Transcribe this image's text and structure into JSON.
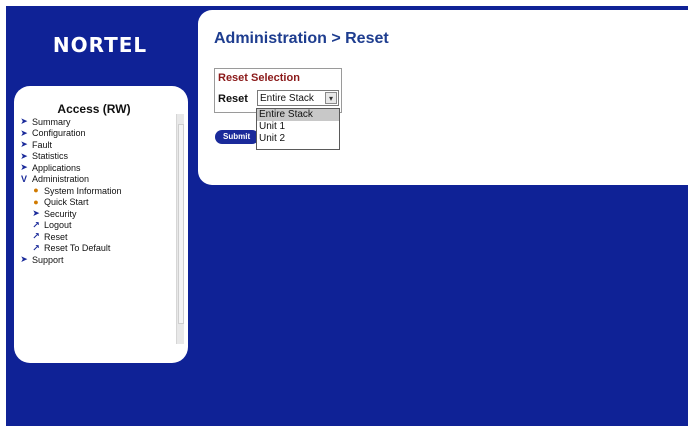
{
  "logo": {
    "text": "NORTEL"
  },
  "nav": {
    "title": "Access (RW)",
    "items": [
      {
        "label": "Summary",
        "icon": "arrow-right-icon"
      },
      {
        "label": "Configuration",
        "icon": "arrow-right-icon"
      },
      {
        "label": "Fault",
        "icon": "arrow-right-icon"
      },
      {
        "label": "Statistics",
        "icon": "arrow-right-icon"
      },
      {
        "label": "Applications",
        "icon": "arrow-right-icon"
      },
      {
        "label": "Administration",
        "icon": "arrow-down-icon"
      },
      {
        "label": "System Information",
        "icon": "bullet-icon",
        "sub": true
      },
      {
        "label": "Quick Start",
        "icon": "bullet-icon",
        "sub": true
      },
      {
        "label": "Security",
        "icon": "arrow-right-icon",
        "sub": true
      },
      {
        "label": "Logout",
        "icon": "curl-arrow-icon",
        "sub": true
      },
      {
        "label": "Reset",
        "icon": "curl-arrow-icon",
        "sub": true
      },
      {
        "label": "Reset To Default",
        "icon": "curl-arrow-icon",
        "sub": true
      },
      {
        "label": "Support",
        "icon": "arrow-right-icon"
      }
    ]
  },
  "main": {
    "page_title": "Administration > Reset",
    "form": {
      "title": "Reset Selection",
      "label": "Reset",
      "selected_value": "Entire Stack",
      "options": [
        "Entire Stack",
        "Unit 1",
        "Unit 2"
      ]
    },
    "submit_label": "Submit"
  },
  "colors": {
    "background": "#0f2296",
    "page_title": "#1e3d8f",
    "form_title": "#8b1a1a",
    "bullet": "#d07a00"
  }
}
